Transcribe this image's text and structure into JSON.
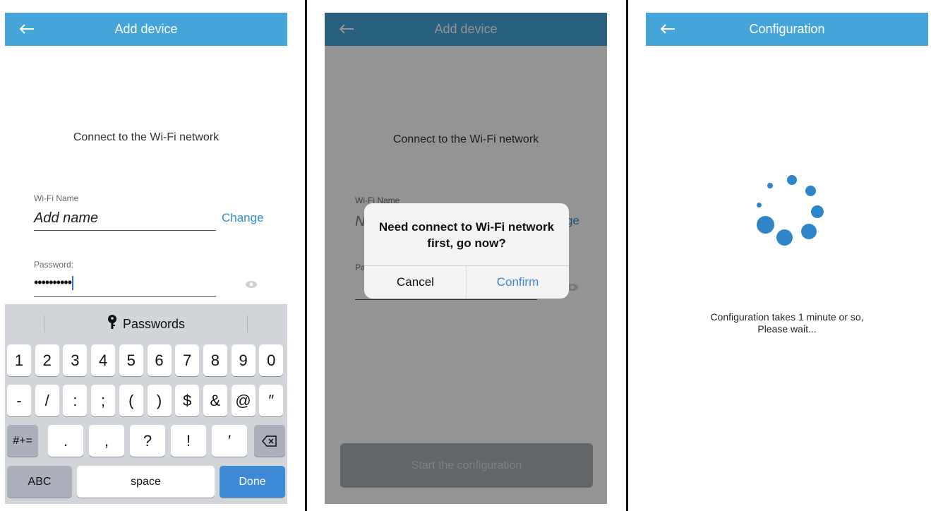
{
  "screen1": {
    "title": "Add device",
    "heading": "Connect to the Wi-Fi network",
    "wifi_label": "Wi-Fi Name",
    "wifi_value": "Add name",
    "change_label": "Change",
    "password_label": "Password:",
    "password_value": "••••••••••",
    "keyboard": {
      "suggestion": "Passwords",
      "row1": [
        "1",
        "2",
        "3",
        "4",
        "5",
        "6",
        "7",
        "8",
        "9",
        "0"
      ],
      "row2": [
        "-",
        "/",
        ":",
        ";",
        "(",
        ")",
        "$",
        "&",
        "@",
        "″"
      ],
      "row3_mode": "#+=",
      "row3": [
        ".",
        ",",
        "?",
        "!",
        "′"
      ],
      "abc": "ABC",
      "space": "space",
      "done": "Done"
    }
  },
  "screen2": {
    "title": "Add device",
    "heading": "Connect to the Wi-Fi network",
    "wifi_label_partial": "Wi-Fi Name",
    "wifi_value_partial": "N",
    "change_partial": "ge",
    "password_partial": "Pa",
    "alert": {
      "message": "Need connect to Wi-Fi network first, go now?",
      "cancel": "Cancel",
      "confirm": "Confirm"
    },
    "start_button": "Start the configuration"
  },
  "screen3": {
    "title": "Configuration",
    "wait_line1": "Configuration takes 1 minute or so,",
    "wait_line2": "Please wait..."
  },
  "colors": {
    "appbar": "#45a5d8",
    "link": "#2e8fd0",
    "done_key": "#3f8ad6",
    "spinner": "#2e86c9"
  }
}
